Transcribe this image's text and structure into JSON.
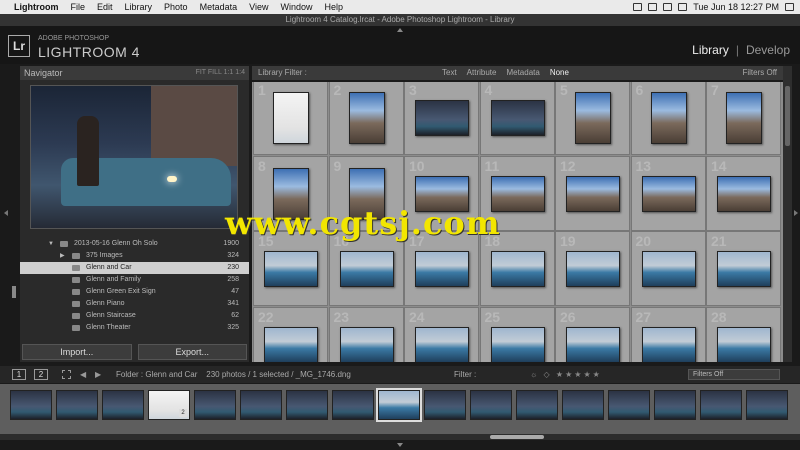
{
  "menubar": {
    "app": "Lightroom",
    "items": [
      "File",
      "Edit",
      "Library",
      "Photo",
      "Metadata",
      "View",
      "Window",
      "Help"
    ],
    "clock": "Tue Jun 18  12:27 PM"
  },
  "window_title": "Lightroom 4 Catalog.lrcat - Adobe Photoshop Lightroom - Library",
  "identity": {
    "badge": "Lr",
    "adobe": "ADOBE PHOTOSHOP",
    "product": "LIGHTROOM 4"
  },
  "modules": {
    "library": "Library",
    "sep": "|",
    "develop": "Develop"
  },
  "navigator": {
    "title": "Navigator",
    "zoom_options": "FIT  FILL  1:1  1:4"
  },
  "folders": [
    {
      "name": "2013-05-16 Glenn Oh Solo",
      "count": "1900",
      "level": 0,
      "selected": false
    },
    {
      "name": "375 Images",
      "count": "324",
      "level": 1,
      "selected": false
    },
    {
      "name": "Glenn and Car",
      "count": "230",
      "level": 1,
      "selected": true
    },
    {
      "name": "Glenn and Family",
      "count": "258",
      "level": 1,
      "selected": false
    },
    {
      "name": "Glenn Green Exit Sign",
      "count": "47",
      "level": 1,
      "selected": false
    },
    {
      "name": "Glenn Piano",
      "count": "341",
      "level": 1,
      "selected": false
    },
    {
      "name": "Glenn Staircase",
      "count": "62",
      "level": 1,
      "selected": false
    },
    {
      "name": "Glenn Theater",
      "count": "325",
      "level": 1,
      "selected": false
    }
  ],
  "left_buttons": {
    "import": "Import...",
    "export": "Export..."
  },
  "filter_bar": {
    "title": "Library Filter :",
    "options": [
      "Text",
      "Attribute",
      "Metadata",
      "None"
    ],
    "active": "None",
    "filters_off": "Filters Off"
  },
  "grid": {
    "cells": [
      {
        "n": "1",
        "o": "port",
        "s": "white"
      },
      {
        "n": "2",
        "o": "port",
        "s": "street"
      },
      {
        "n": "3",
        "o": "land",
        "s": "night"
      },
      {
        "n": "4",
        "o": "land",
        "s": "night"
      },
      {
        "n": "5",
        "o": "port",
        "s": "street"
      },
      {
        "n": "6",
        "o": "port",
        "s": "street"
      },
      {
        "n": "7",
        "o": "port",
        "s": "street"
      },
      {
        "n": "8",
        "o": "port",
        "s": "street"
      },
      {
        "n": "9",
        "o": "port",
        "s": "street"
      },
      {
        "n": "10",
        "o": "land",
        "s": "street"
      },
      {
        "n": "11",
        "o": "land",
        "s": "street"
      },
      {
        "n": "12",
        "o": "land",
        "s": "street"
      },
      {
        "n": "13",
        "o": "land",
        "s": "street"
      },
      {
        "n": "14",
        "o": "land",
        "s": "street"
      },
      {
        "n": "15",
        "o": "land",
        "s": "blue"
      },
      {
        "n": "16",
        "o": "land",
        "s": "blue"
      },
      {
        "n": "17",
        "o": "land",
        "s": "blue"
      },
      {
        "n": "18",
        "o": "land",
        "s": "blue"
      },
      {
        "n": "19",
        "o": "land",
        "s": "blue"
      },
      {
        "n": "20",
        "o": "land",
        "s": "blue"
      },
      {
        "n": "21",
        "o": "land",
        "s": "blue"
      },
      {
        "n": "22",
        "o": "land",
        "s": "blue"
      },
      {
        "n": "23",
        "o": "land",
        "s": "blue"
      },
      {
        "n": "24",
        "o": "land",
        "s": "blue"
      },
      {
        "n": "25",
        "o": "land",
        "s": "blue"
      },
      {
        "n": "26",
        "o": "land",
        "s": "blue"
      },
      {
        "n": "27",
        "o": "land",
        "s": "blue"
      },
      {
        "n": "28",
        "o": "land",
        "s": "blue"
      }
    ]
  },
  "toolbar": {
    "monitor1": "1",
    "monitor2": "2",
    "source": "Folder : Glenn and Car",
    "info": "230 photos / 1 selected / _MG_1746.dng",
    "filter_label": "Filter :",
    "filter_select": "Filters Off"
  },
  "filmstrip": {
    "thumbs": [
      "night",
      "night",
      "night",
      "white",
      "night",
      "night",
      "night",
      "night",
      "blue",
      "night",
      "night",
      "night",
      "night",
      "night",
      "night",
      "night",
      "night"
    ],
    "selected_index": 8,
    "badge_index": 3,
    "badge_text": "2"
  },
  "watermark": "www.cgtsj.com",
  "colors": {
    "selected_folder_bg": "#cfcfcf",
    "grid_bg": "#8c8c8c",
    "cell_bg": "#a4a4a4",
    "watermark": "#f2e600"
  }
}
